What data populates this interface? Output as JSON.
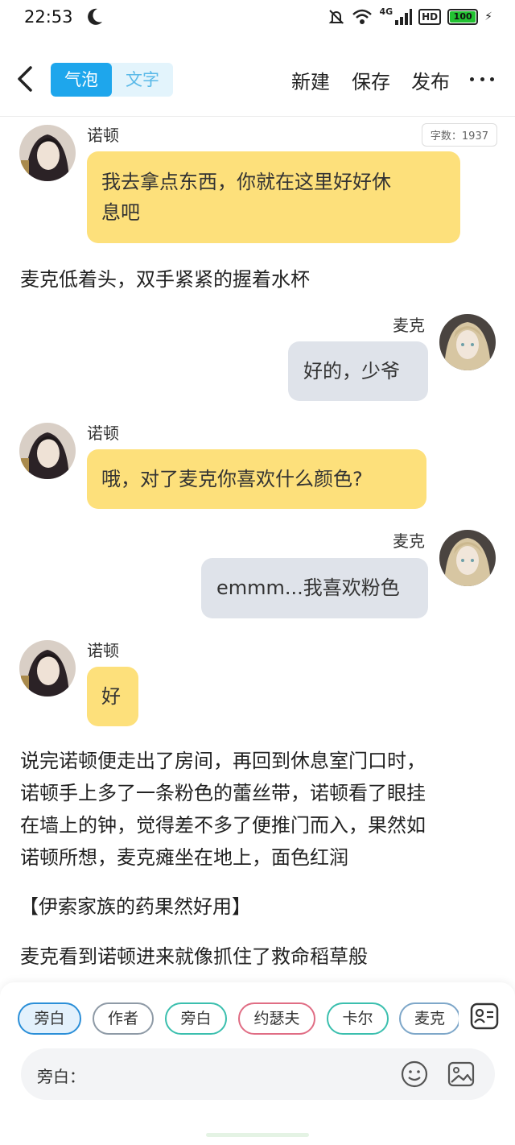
{
  "status_bar": {
    "time": "22:53",
    "network": "4G",
    "hd": "HD",
    "battery": "100"
  },
  "header": {
    "tabs": [
      {
        "label": "气泡",
        "active": true
      },
      {
        "label": "文字",
        "active": false
      }
    ],
    "actions": {
      "new": "新建",
      "save": "保存",
      "publish": "发布"
    }
  },
  "word_count": "字数：1937",
  "messages": [
    {
      "type": "bubble",
      "side": "left",
      "speaker": "诺顿",
      "lines": [
        "我去拿点东西，你就在这里好好休",
        "息吧"
      ]
    },
    {
      "type": "narration",
      "lines": [
        "麦克低着头，双手紧紧的握着水杯"
      ]
    },
    {
      "type": "bubble",
      "side": "right",
      "speaker": "麦克",
      "lines": [
        "好的，少爷"
      ]
    },
    {
      "type": "bubble",
      "side": "left",
      "speaker": "诺顿",
      "lines": [
        "哦，对了麦克你喜欢什么颜色?"
      ]
    },
    {
      "type": "bubble",
      "side": "right",
      "speaker": "麦克",
      "lines": [
        "emmm...我喜欢粉色"
      ]
    },
    {
      "type": "bubble",
      "side": "left",
      "speaker": "诺顿",
      "lines": [
        "好"
      ]
    },
    {
      "type": "narration",
      "lines": [
        "说完诺顿便走出了房间，再回到休息室门口时，",
        "诺顿手上多了一条粉色的蕾丝带，诺顿看了眼挂",
        "在墙上的钟，觉得差不多了便推门而入，果然如",
        "诺顿所想，麦克瘫坐在地上，面色红润"
      ]
    },
    {
      "type": "narration",
      "lines": [
        "【伊索家族的药果然好用】"
      ]
    },
    {
      "type": "narration",
      "lines": [
        "麦克看到诺顿进来就像抓住了救命稻草般"
      ]
    }
  ],
  "roles": [
    {
      "label": "旁白",
      "style": "selected"
    },
    {
      "label": "作者",
      "style": "gray"
    },
    {
      "label": "旁白",
      "style": "teal"
    },
    {
      "label": "约瑟夫",
      "style": "pink"
    },
    {
      "label": "卡尔",
      "style": "teal"
    },
    {
      "label": "麦克",
      "style": "blue"
    }
  ],
  "input": {
    "label": "旁白："
  },
  "colors": {
    "accent": "#1ea6ec",
    "bubble_left": "#fde07b",
    "bubble_right": "#dfe3ea"
  },
  "icons": [
    "back-arrow-icon",
    "more-icon",
    "moon-icon",
    "role-cards-icon",
    "emoji-icon",
    "image-icon"
  ]
}
